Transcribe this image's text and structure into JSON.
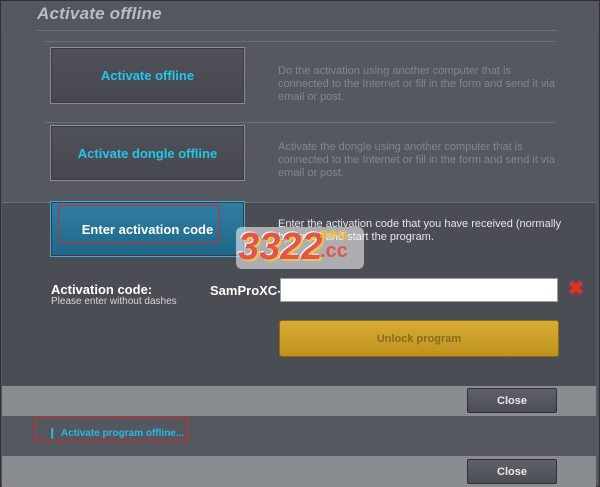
{
  "window": {
    "title": "Activate offline"
  },
  "options": [
    {
      "label": "Activate offline",
      "description": "Do the activation using another computer that is connected to the Internet or fill in the form and send it via email or post."
    },
    {
      "label": "Activate dongle offline",
      "description": "Activate the dongle using another computer that is connected to the Internet or fill in the form and send it via email or post."
    },
    {
      "label": "Enter activation code",
      "description": "Enter the activation code that you have received (normally by email) and start the program."
    }
  ],
  "activation": {
    "label": "Activation code:",
    "hint": "Please enter without dashes",
    "prefix": "SamProXC-",
    "value": "",
    "placeholder": ""
  },
  "unlock_label": "Unlock program",
  "close_label": "Close",
  "footer_link": "Activate program offline...",
  "watermark": {
    "number": "3322",
    "suffix": ".cc",
    "cn": "软件站"
  },
  "colors": {
    "accent": "#27c4ea",
    "unlock": "#c99e26",
    "highlight": "#e0232a",
    "clear": "#e03226"
  }
}
